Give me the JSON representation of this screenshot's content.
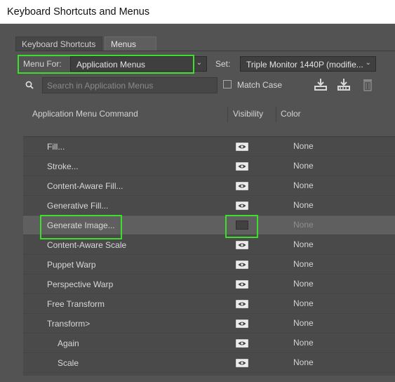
{
  "window": {
    "title": "Keyboard Shortcuts and Menus"
  },
  "tabs": [
    {
      "label": "Keyboard Shortcuts",
      "active": false
    },
    {
      "label": "Menus",
      "active": true
    }
  ],
  "menu_for": {
    "label": "Menu For:",
    "value": "Application Menus"
  },
  "set": {
    "label": "Set:",
    "value": "Triple Monitor 1440P (modifie..."
  },
  "search": {
    "placeholder": "Search in Application Menus"
  },
  "match_case": {
    "label": "Match Case",
    "checked": false
  },
  "columns": {
    "command": "Application Menu Command",
    "visibility": "Visibility",
    "color": "Color"
  },
  "rows": [
    {
      "command": "Fill...",
      "color": "None",
      "visible": true
    },
    {
      "command": "Stroke...",
      "color": "None",
      "visible": true
    },
    {
      "command": "Content-Aware Fill...",
      "color": "None",
      "visible": true
    },
    {
      "command": "Generative Fill...",
      "color": "None",
      "visible": true
    },
    {
      "command": "Generate Image...",
      "color": "None",
      "visible": false
    },
    {
      "command": "Content-Aware Scale",
      "color": "None",
      "visible": true
    },
    {
      "command": "Puppet Warp",
      "color": "None",
      "visible": true
    },
    {
      "command": "Perspective Warp",
      "color": "None",
      "visible": true
    },
    {
      "command": "Free Transform",
      "color": "None",
      "visible": true
    },
    {
      "command": "Transform>",
      "color": "None",
      "visible": true
    },
    {
      "command": "Again",
      "color": "None",
      "visible": true
    },
    {
      "command": "Scale",
      "color": "None",
      "visible": true
    }
  ],
  "colors": {
    "highlight": "#3cdf2a",
    "panel": "#535353"
  }
}
